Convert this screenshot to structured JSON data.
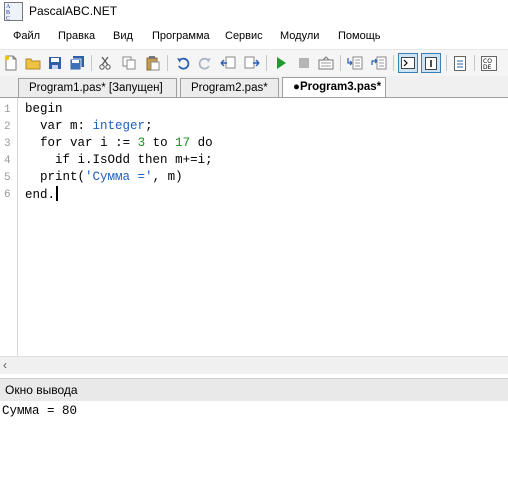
{
  "window": {
    "logo_text": "ABC .NET",
    "title": "PascalABC.NET"
  },
  "menu": [
    "Файл",
    "Правка",
    "Вид",
    "Программа",
    "Сервис",
    "Модули",
    "Помощь"
  ],
  "tabs": [
    {
      "label": "Program1.pas* [Запущен]",
      "active": false
    },
    {
      "label": "Program2.pas*",
      "active": false
    },
    {
      "label": "●Program3.pas*",
      "active": true
    }
  ],
  "editor": {
    "line_numbers": [
      "1",
      "2",
      "3",
      "4",
      "5",
      "6"
    ],
    "lines": [
      "begin",
      "  var m: integer;",
      "  for var i := 3 to 17 do",
      "    if i.IsOdd then m+=i;",
      "  print('Сумма =', m)",
      "end."
    ]
  },
  "output": {
    "title": "Окно вывода",
    "text": "Сумма = 80"
  },
  "toolbar_icons": [
    "new-file-icon",
    "open-folder-icon",
    "save-icon",
    "save-all-icon",
    "cut-icon",
    "copy-icon",
    "paste-icon",
    "undo-icon",
    "redo-icon",
    "back-icon",
    "forward-icon",
    "run-icon",
    "stop-icon",
    "compile-icon",
    "step-into-icon",
    "step-over-icon",
    "output-window-icon",
    "immediate-window-icon",
    "document-icon",
    "code-icon"
  ],
  "colors": {
    "keyword": "#000000",
    "type": "#1f5fbf",
    "number": "#1a8f1a",
    "string": "#1f5fbf",
    "toolbar_pressed": "#cfe3f7"
  }
}
